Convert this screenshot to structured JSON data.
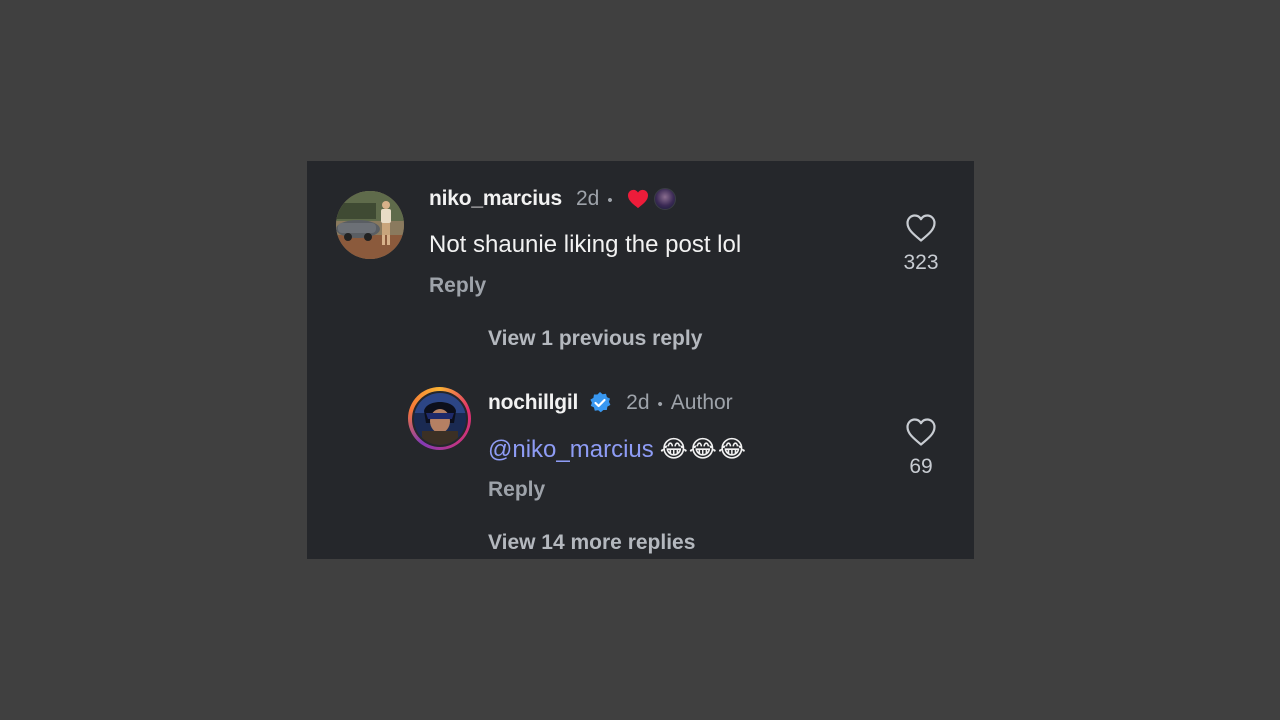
{
  "comment": {
    "username": "niko_marcius",
    "time": "2d",
    "separator": "•",
    "text": "Not shaunie liking the post lol",
    "reply_label": "Reply",
    "likes": "323"
  },
  "view_previous": "View 1 previous reply",
  "reply": {
    "username": "nochillgil",
    "time": "2d",
    "separator": "•",
    "author_label": "Author",
    "mention": "@niko_marcius",
    "emojis": "😂😂😂",
    "reply_label": "Reply",
    "likes": "69"
  },
  "view_more": "View 14 more replies",
  "colors": {
    "background": "#404040",
    "panel": "#25272b",
    "mention": "#8e9cf5",
    "verified": "#3897f0",
    "liked_heart": "#ed1c3a"
  },
  "icons": {
    "like": "heart-outline-icon",
    "creator_liked": "heart-filled-icon",
    "verified": "verified-badge-icon"
  }
}
